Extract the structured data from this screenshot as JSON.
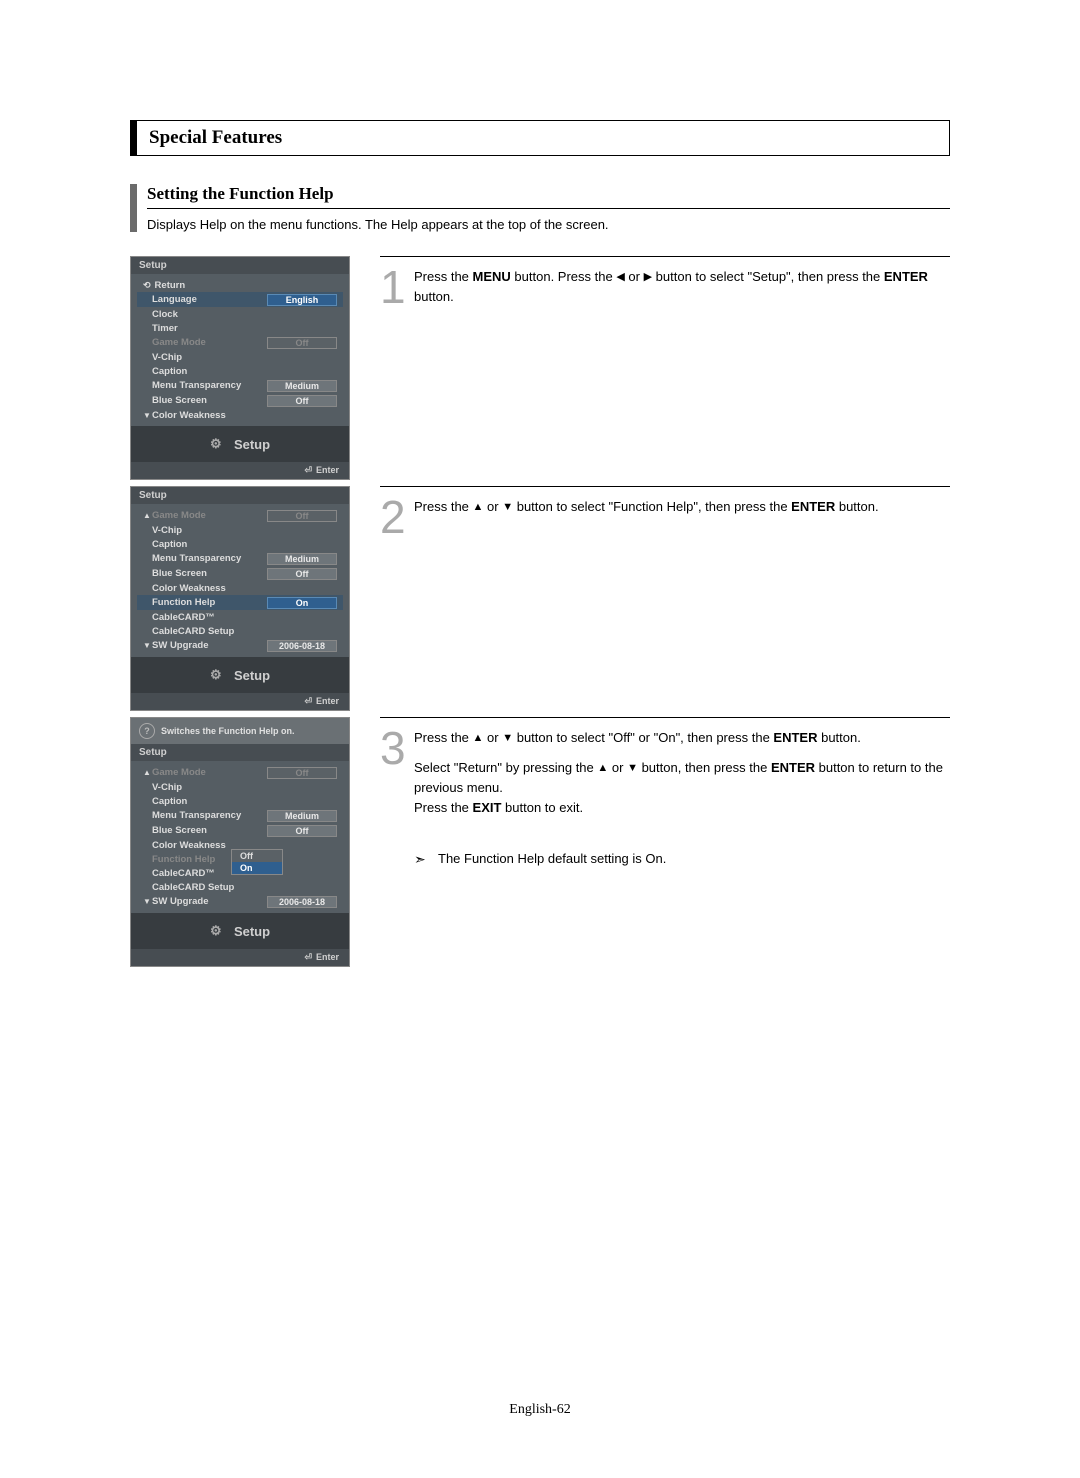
{
  "header": {
    "section": "Special Features"
  },
  "subhead": {
    "title": "Setting the Function Help",
    "desc": "Displays Help on the menu functions. The Help appears at the top of the screen."
  },
  "steps": {
    "s1": {
      "num": "1",
      "a": "Press the ",
      "a2": " button. Press the ",
      "a3": " or ",
      "a4": " button to select \"Setup\", then press the ",
      "a5": " button.",
      "w1": "MENU",
      "w2": "ENTER"
    },
    "s2": {
      "num": "2",
      "a": "Press the ",
      "a2": " or ",
      "a3": " button to select \"Function Help\", then press the ",
      "a4": " button.",
      "w1": "ENTER"
    },
    "s3": {
      "num": "3",
      "p1a": "Press the ",
      "p1b": " or ",
      "p1c": " button to select \"Off\" or \"On\", then press the ",
      "p1d": " button.",
      "w1": "ENTER",
      "p2a": "Select \"Return\" by pressing the ",
      "p2b": " or ",
      "p2c": " button, then press the ",
      "p2d": " button to return to the previous menu.",
      "w2": "ENTER",
      "p3a": "Press the ",
      "p3b": " button to exit.",
      "w3": "EXIT"
    }
  },
  "note": {
    "mark": "➣",
    "text": "The Function Help default setting is On."
  },
  "osd_common": {
    "setup": "Setup",
    "enter": "Enter",
    "return": "Return",
    "gear": "⚙"
  },
  "osd1": {
    "rows": [
      {
        "label": "Language",
        "value": "English",
        "hl": true
      },
      {
        "label": "Clock"
      },
      {
        "label": "Timer"
      },
      {
        "label": "Game Mode",
        "value": "Off",
        "dim": true
      },
      {
        "label": "V-Chip"
      },
      {
        "label": "Caption"
      },
      {
        "label": "Menu Transparency",
        "value": "Medium"
      },
      {
        "label": "Blue Screen",
        "value": "Off"
      },
      {
        "label": "Color Weakness",
        "pre": "▼"
      }
    ]
  },
  "osd2": {
    "rows": [
      {
        "label": "Game Mode",
        "value": "Off",
        "dim": true,
        "pre": "▲"
      },
      {
        "label": "V-Chip"
      },
      {
        "label": "Caption"
      },
      {
        "label": "Menu Transparency",
        "value": "Medium"
      },
      {
        "label": "Blue Screen",
        "value": "Off"
      },
      {
        "label": "Color Weakness"
      },
      {
        "label": "Function Help",
        "value": "On",
        "hl": true
      },
      {
        "label": "CableCARD™"
      },
      {
        "label": "CableCARD Setup"
      },
      {
        "label": "SW Upgrade",
        "value": "2006-08-18",
        "pre": "▼"
      }
    ]
  },
  "osd3": {
    "help": "Switches the Function Help on.",
    "rows": [
      {
        "label": "Game Mode",
        "value": "Off",
        "dim": true,
        "pre": "▲"
      },
      {
        "label": "V-Chip"
      },
      {
        "label": "Caption"
      },
      {
        "label": "Menu Transparency",
        "value": "Medium"
      },
      {
        "label": "Blue Screen",
        "value": "Off"
      },
      {
        "label": "Color Weakness"
      },
      {
        "label": "Function Help",
        "dim": true
      },
      {
        "label": "CableCARD™"
      },
      {
        "label": "CableCARD Setup"
      },
      {
        "label": "SW Upgrade",
        "value": "2006-08-18",
        "pre": "▼"
      }
    ],
    "popup": {
      "opts": [
        "Off",
        "On"
      ],
      "sel": 1
    }
  },
  "footer": {
    "text": "English-62"
  }
}
